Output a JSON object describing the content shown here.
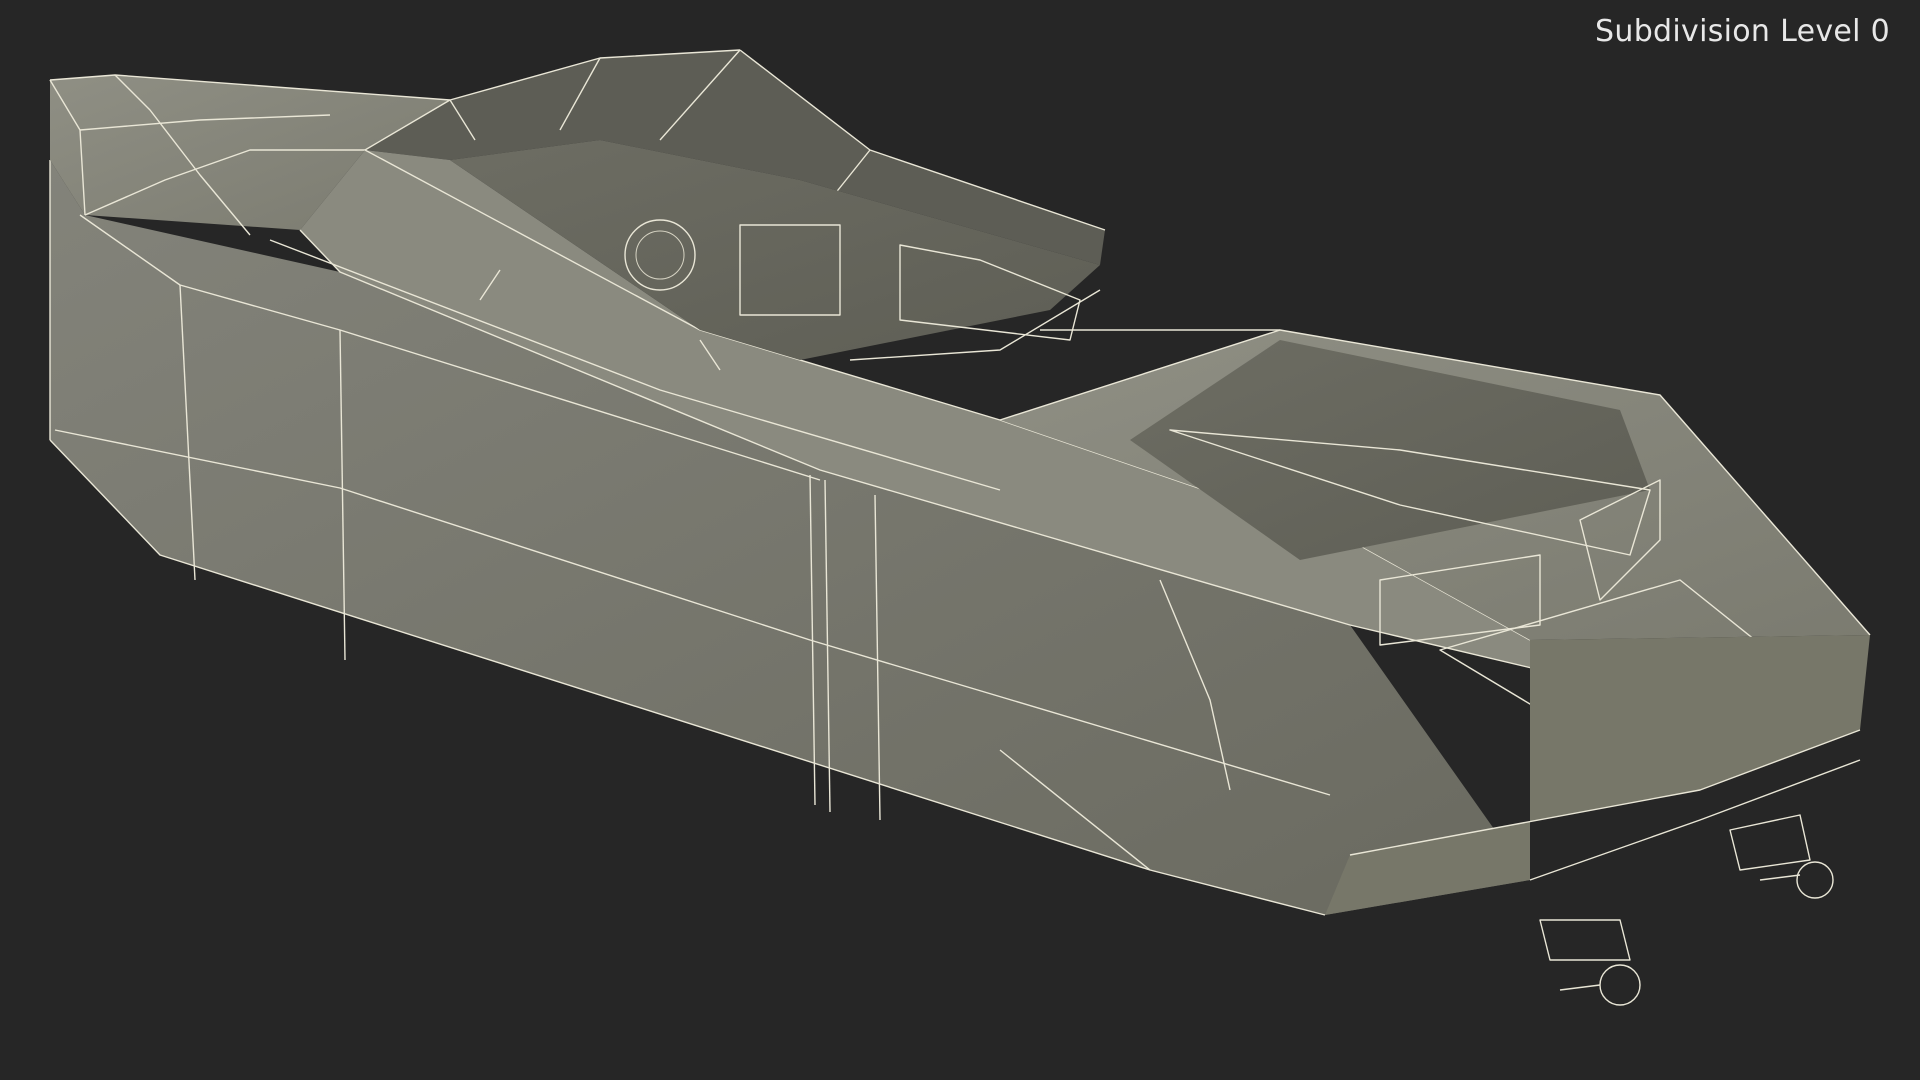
{
  "viewport": {
    "label": "Subdivision Level 0",
    "background": "#262626"
  },
  "model": {
    "shading_dark": "#6f6f64",
    "shading_mid": "#7e7e72",
    "shading_light": "#8c8c80",
    "wire_color": "#e9e6d6"
  }
}
